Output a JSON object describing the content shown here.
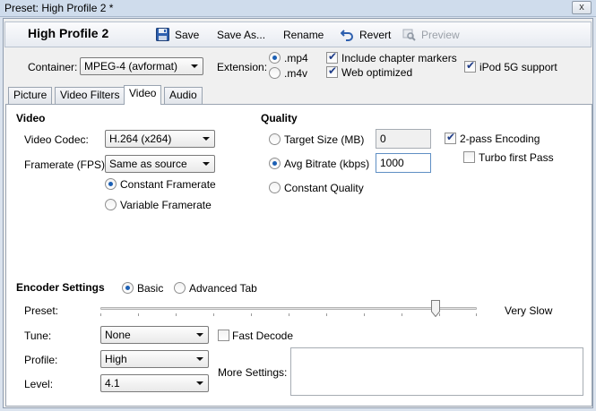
{
  "window": {
    "title": "Preset: High Profile 2 *",
    "close": "x"
  },
  "toolbar": {
    "profile_name": "High Profile 2",
    "save": "Save",
    "save_as": "Save As...",
    "rename": "Rename",
    "revert": "Revert",
    "preview": "Preview"
  },
  "container": {
    "label": "Container:",
    "value": "MPEG-4 (avformat)",
    "extension_label": "Extension:",
    "ext_mp4": ".mp4",
    "ext_m4v": ".m4v",
    "include_chapter_markers": "Include chapter markers",
    "web_optimized": "Web optimized",
    "ipod_5g_support": "iPod 5G support"
  },
  "tabs": [
    "Picture",
    "Video Filters",
    "Video",
    "Audio"
  ],
  "video": {
    "section_title": "Video",
    "codec_label": "Video Codec:",
    "codec_value": "H.264 (x264)",
    "framerate_label": "Framerate (FPS):",
    "framerate_value": "Same as source",
    "constant_framerate": "Constant Framerate",
    "variable_framerate": "Variable Framerate"
  },
  "quality": {
    "section_title": "Quality",
    "target_size_label": "Target Size (MB)",
    "target_size_value": "0",
    "avg_bitrate_label": "Avg Bitrate (kbps)",
    "avg_bitrate_value": "1000",
    "constant_quality_label": "Constant Quality",
    "two_pass": "2-pass Encoding",
    "turbo_first_pass": "Turbo first Pass"
  },
  "encoder": {
    "section_title": "Encoder Settings",
    "basic": "Basic",
    "advanced_tab": "Advanced Tab",
    "preset_label": "Preset:",
    "preset_value": "Very Slow",
    "preset_level": 0.89,
    "tune_label": "Tune:",
    "tune_value": "None",
    "fast_decode": "Fast Decode",
    "profile_label": "Profile:",
    "profile_value": "High",
    "level_label": "Level:",
    "level_value": "4.1",
    "more_settings_label": "More Settings:",
    "more_settings_value": ""
  },
  "icons": {
    "save": "save-icon",
    "revert": "revert-icon",
    "preview": "preview-icon"
  },
  "colors": {
    "accent": "#1b5fb4",
    "window_chrome": "#cfdcec"
  }
}
